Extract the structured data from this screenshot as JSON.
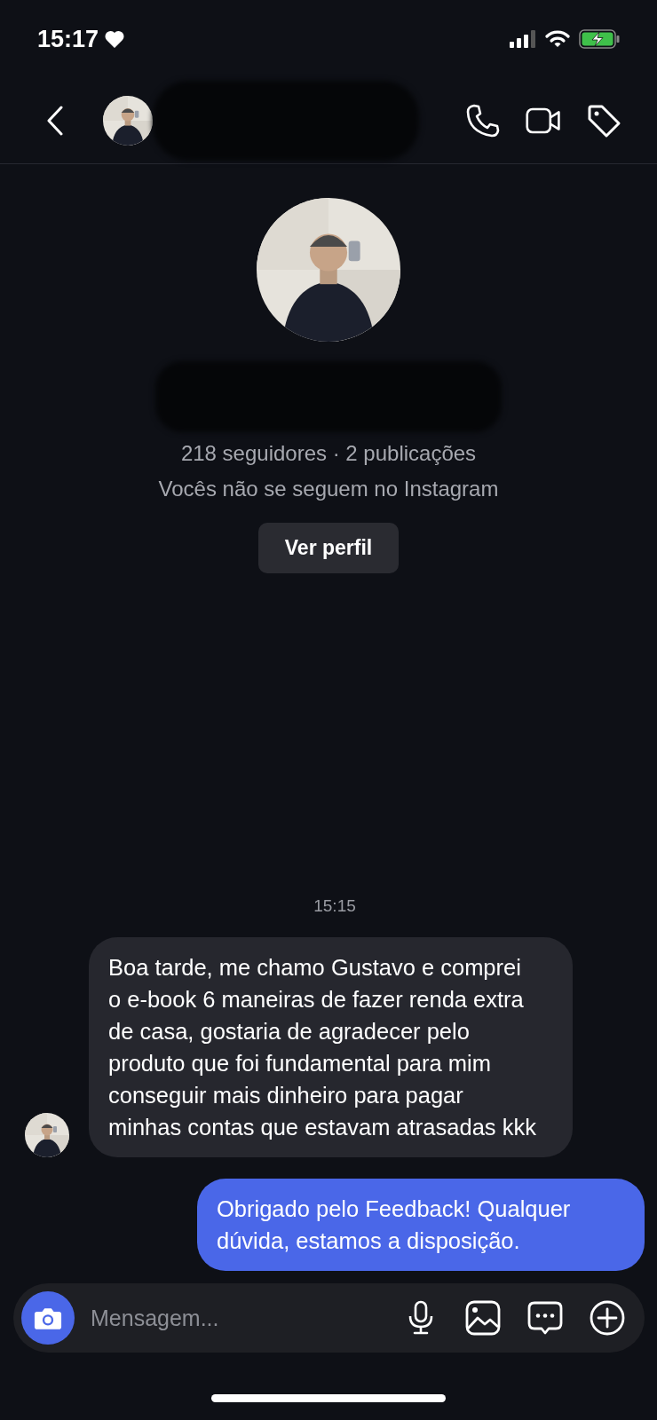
{
  "status_bar": {
    "time": "15:17"
  },
  "header": {
    "redacted": true
  },
  "profile": {
    "redacted": true,
    "stats": "218 seguidores · 2 publicações",
    "relation": "Vocês não se seguem no Instagram",
    "button": "Ver perfil"
  },
  "messages": [
    {
      "kind": "timestamp",
      "text": "15:15"
    },
    {
      "kind": "received",
      "text": "Boa tarde, me chamo Gustavo e comprei o e-book 6 maneiras de fazer renda extra de casa, gostaria de agradecer pelo produto que foi fundamental para mim conseguir mais dinheiro para pagar minhas contas que estavam atrasadas kkk"
    },
    {
      "kind": "sent",
      "text": "Obrigado pelo Feedback! Qualquer dúvida, estamos a disposição."
    }
  ],
  "composer": {
    "placeholder": "Mensagem..."
  }
}
